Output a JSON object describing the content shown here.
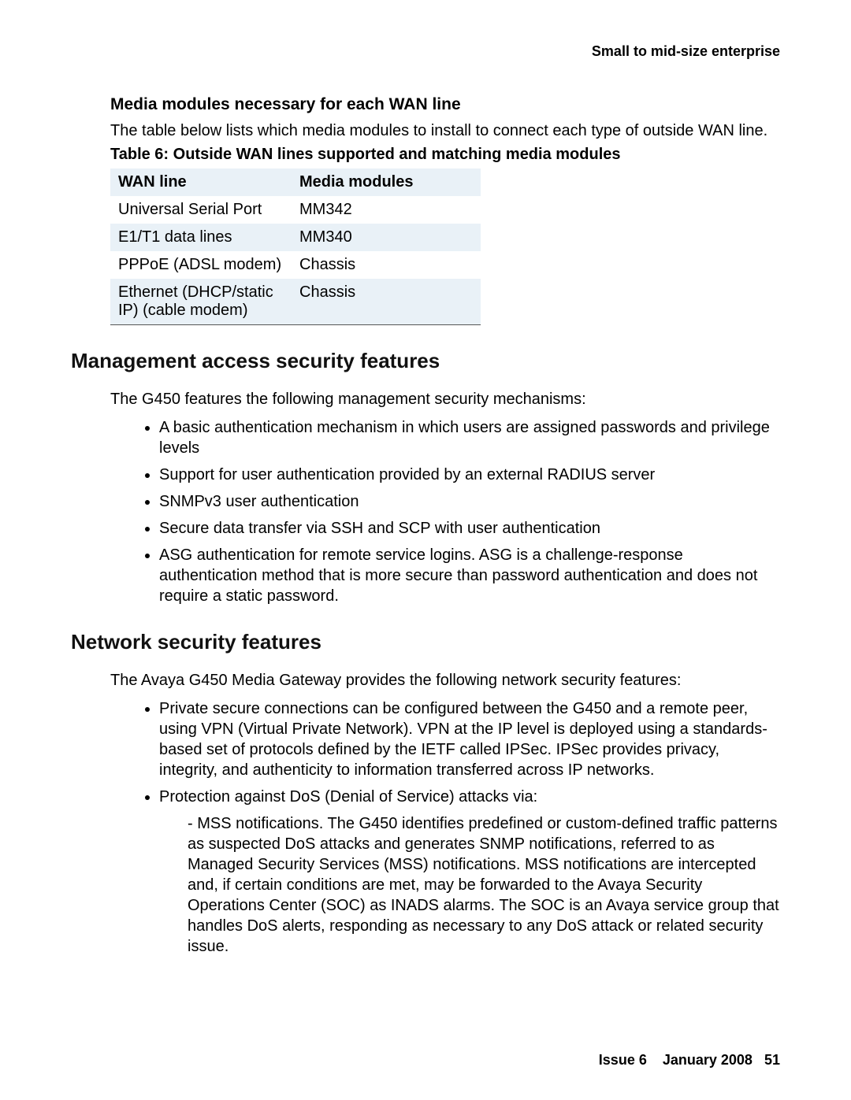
{
  "header": {
    "section_label": "Small to mid-size enterprise"
  },
  "media_modules": {
    "heading": "Media modules necessary for each WAN line",
    "intro": "The table below lists which media modules to install to connect each type of outside WAN line.",
    "table_caption": "Table 6: Outside WAN lines supported and matching media modules",
    "columns": {
      "wan_line": "WAN line",
      "media_modules": "Media modules"
    },
    "rows": [
      {
        "wan_line": "Universal Serial Port",
        "media_modules": "MM342"
      },
      {
        "wan_line": "E1/T1 data lines",
        "media_modules": "MM340"
      },
      {
        "wan_line": "PPPoE (ADSL modem)",
        "media_modules": "Chassis"
      },
      {
        "wan_line": "Ethernet (DHCP/static IP) (cable modem)",
        "media_modules": "Chassis"
      }
    ]
  },
  "mgmt_security": {
    "heading": "Management access security features",
    "intro": "The G450 features the following management security mechanisms:",
    "items": [
      "A basic authentication mechanism in which users are assigned passwords and privilege levels",
      "Support for user authentication provided by an external RADIUS server",
      "SNMPv3 user authentication",
      "Secure data transfer via SSH and SCP with user authentication",
      "ASG authentication for remote service logins. ASG is a challenge-response authentication method that is more secure than password authentication and does not require a static password."
    ]
  },
  "net_security": {
    "heading": "Network security features",
    "intro": "The Avaya G450 Media Gateway provides the following network security features:",
    "items": [
      "Private secure connections can be configured between the G450 and a remote peer, using VPN (Virtual Private Network). VPN at the IP level is deployed using a standards-based set of protocols defined by the IETF called IPSec. IPSec provides privacy, integrity, and authenticity to information transferred across IP networks.",
      "Protection against DoS (Denial of Service) attacks via:"
    ],
    "sub_items": [
      "MSS notifications. The G450 identifies predefined or custom-defined traffic patterns as suspected DoS attacks and generates SNMP notifications, referred to as Managed Security Services (MSS) notifications. MSS notifications are intercepted and, if certain conditions are met, may be forwarded to the Avaya Security Operations Center (SOC) as INADS alarms. The SOC is an Avaya service group that handles DoS alerts, responding as necessary to any DoS attack or related security issue."
    ]
  },
  "footer": {
    "issue": "Issue 6",
    "date": "January 2008",
    "page": "51"
  }
}
